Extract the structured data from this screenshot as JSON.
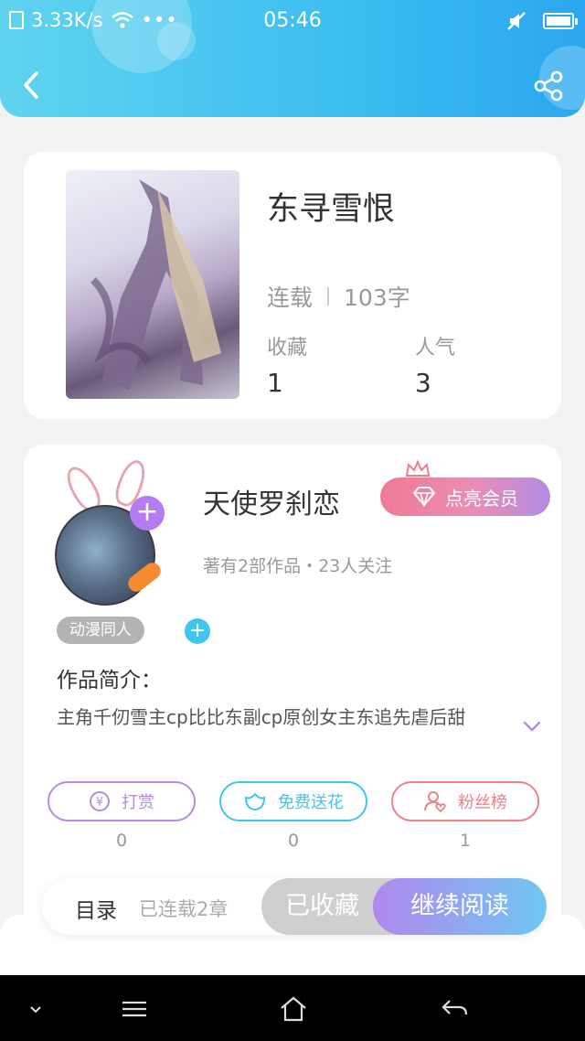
{
  "status_bar": {
    "speed": "3.33K/s",
    "dots": "•••",
    "time": "05:46"
  },
  "book": {
    "title": "东寻雪恨",
    "status": "连载",
    "word_count": "103字",
    "stats": [
      {
        "label": "收藏",
        "value": "1"
      },
      {
        "label": "人气",
        "value": "3"
      }
    ]
  },
  "author": {
    "name": "天使罗刹恋",
    "vip_label": "点亮会员",
    "meta": "著有2部作品・23人关注",
    "tag": "动漫同人"
  },
  "intro": {
    "label": "作品简介：",
    "text": "主角千仞雪主cp比比东副cp原创女主东追先虐后甜"
  },
  "actions": [
    {
      "label": "打赏",
      "count": "0",
      "color": "#b48be8"
    },
    {
      "label": "免费送花",
      "count": "0",
      "color": "#3fc6ec"
    },
    {
      "label": "粉丝榜",
      "count": "1",
      "color": "#ef7f8a"
    }
  ],
  "bottom_bar": {
    "toc_label": "目录",
    "chapters": "已连载2章",
    "collected_label": "已收藏",
    "continue_label": "继续阅读"
  },
  "icons": [
    "wifi-icon",
    "back-icon",
    "share-icon",
    "gift-icon",
    "flower-icon",
    "fans-icon",
    "menu-icon",
    "home-icon",
    "return-icon"
  ]
}
